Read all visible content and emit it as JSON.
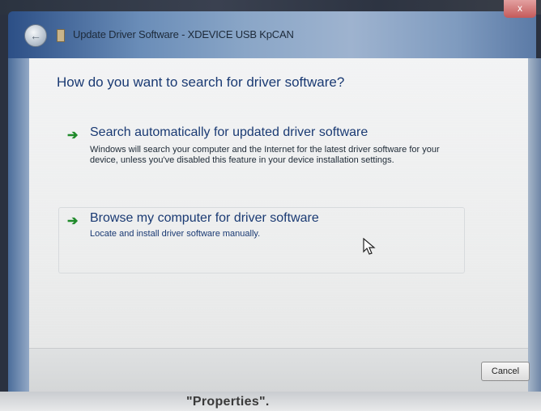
{
  "window": {
    "title": "Update Driver Software - XDEVICE USB KpCAN",
    "close_label": "x"
  },
  "dialog": {
    "heading": "How do you want to search for driver software?",
    "options": [
      {
        "title": "Search automatically for updated driver software",
        "description": "Windows will search your computer and the Internet for the latest driver software for your device, unless you've disabled this feature in your device installation settings."
      },
      {
        "title": "Browse my computer for driver software",
        "description": "Locate and install driver software manually."
      }
    ],
    "cancel_label": "Cancel"
  },
  "caption": "\"Properties\".",
  "icons": {
    "back": "back-arrow-icon",
    "option_arrow": "green-arrow-icon",
    "cursor": "mouse-pointer-icon"
  },
  "colors": {
    "accent_text": "#1a3a73",
    "arrow_green": "#1f8a2a"
  }
}
